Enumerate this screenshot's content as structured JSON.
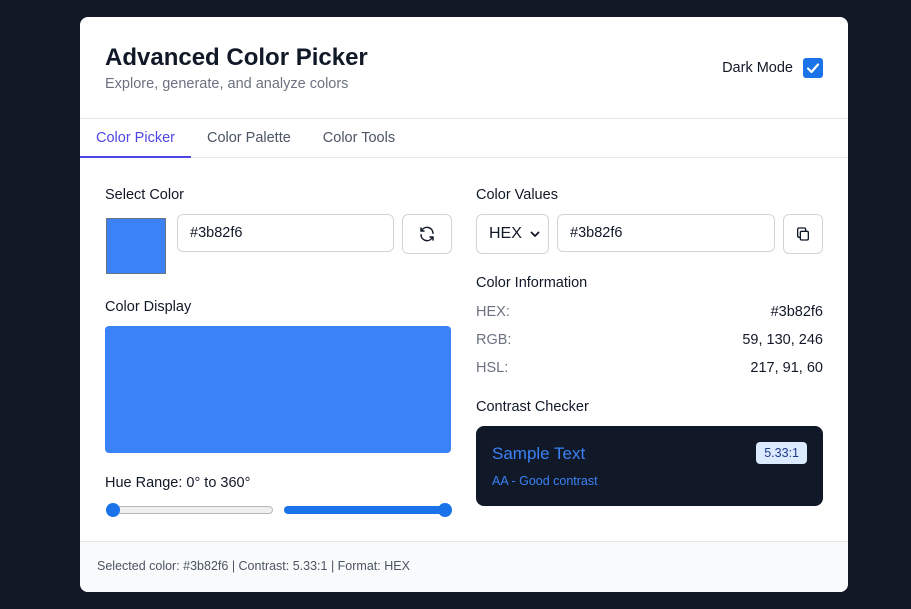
{
  "header": {
    "title": "Advanced Color Picker",
    "subtitle": "Explore, generate, and analyze colors",
    "dark_mode_label": "Dark Mode",
    "dark_mode_checked": true
  },
  "tabs": [
    {
      "label": "Color Picker",
      "active": true
    },
    {
      "label": "Color Palette",
      "active": false
    },
    {
      "label": "Color Tools",
      "active": false
    }
  ],
  "picker": {
    "select_color_label": "Select Color",
    "swatch_color": "#3b82f6",
    "hex_input_value": "#3b82f6",
    "refresh_icon": "refresh-icon",
    "color_display_label": "Color Display",
    "hue_range_label": "Hue Range: 0° to 360°",
    "hue_min_value": 0,
    "hue_max_value": 360
  },
  "values": {
    "color_values_label": "Color Values",
    "format_selected": "HEX",
    "value_input": "#3b82f6",
    "copy_icon": "copy-icon"
  },
  "info": {
    "label": "Color Information",
    "rows": [
      {
        "key": "HEX:",
        "value": "#3b82f6"
      },
      {
        "key": "RGB:",
        "value": "59, 130, 246"
      },
      {
        "key": "HSL:",
        "value": "217, 91, 60"
      }
    ]
  },
  "contrast": {
    "label": "Contrast Checker",
    "sample_text": "Sample Text",
    "rating": "AA - Good contrast",
    "ratio": "5.33:1"
  },
  "footer": {
    "status": "Selected color: #3b82f6 | Contrast: 5.33:1 | Format: HEX"
  },
  "colors": {
    "accent": "#4f46e5",
    "primary": "#3b82f6",
    "dark_panel": "#111827"
  }
}
